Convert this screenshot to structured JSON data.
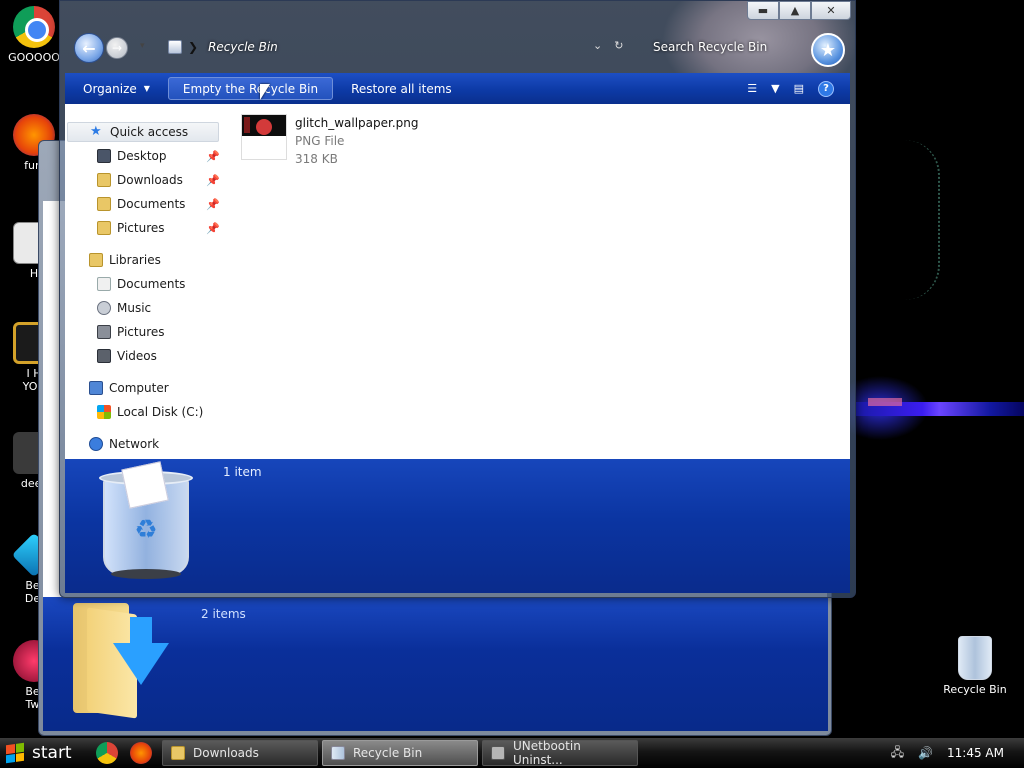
{
  "desktop": {
    "icons": [
      {
        "id": "chrome",
        "label": "GOOOOO"
      },
      {
        "id": "firefox",
        "label": "furr"
      },
      {
        "id": "app-h",
        "label": "H"
      },
      {
        "id": "app-i",
        "label": "I H\nYOU"
      },
      {
        "id": "deezer",
        "label": "deez"
      },
      {
        "id": "bejeweled",
        "label": "Bej\nDel"
      },
      {
        "id": "bejeweled-twist",
        "label": "Bej\nTwi"
      },
      {
        "id": "recycle-bin",
        "label": "Recycle Bin"
      }
    ]
  },
  "background_window": {
    "item_count": "2 items"
  },
  "window": {
    "address": {
      "path": "Recycle Bin"
    },
    "search": {
      "placeholder": "Search Recycle Bin"
    },
    "caption": {
      "minimize": "▬",
      "maximize": "▲",
      "close": "✕"
    },
    "command_bar": {
      "organize": "Organize",
      "empty_bin": "Empty the Recycle Bin",
      "restore_all": "Restore all items"
    },
    "nav": {
      "quick_access": "Quick access",
      "quick_items": [
        "Desktop",
        "Downloads",
        "Documents",
        "Pictures"
      ],
      "libraries": "Libraries",
      "library_items": [
        "Documents",
        "Music",
        "Pictures",
        "Videos"
      ],
      "computer": "Computer",
      "computer_items": [
        "Local Disk (C:)"
      ],
      "network": "Network"
    },
    "files": [
      {
        "name": "glitch_wallpaper.png",
        "type": "PNG File",
        "size": "318 KB"
      }
    ],
    "details": {
      "item_count": "1 item"
    }
  },
  "taskbar": {
    "start_label": "start",
    "tasks": [
      {
        "label": "Downloads",
        "active": false
      },
      {
        "label": "Recycle Bin",
        "active": true
      },
      {
        "label": "UNetbootin Uninst...",
        "active": false
      }
    ],
    "clock": "11:45 AM"
  },
  "colors": {
    "command_bar": "#0d3aa6",
    "details_pane": "#0b35a2",
    "taskbar": "#151515"
  }
}
